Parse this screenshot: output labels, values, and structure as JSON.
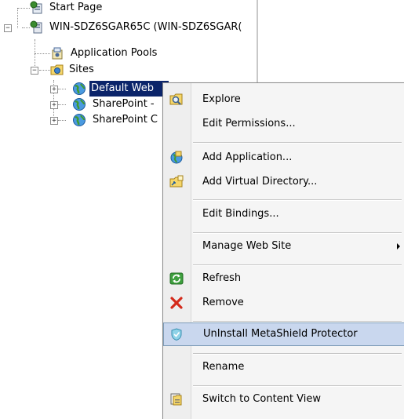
{
  "tree": {
    "nodes": [
      {
        "label": "Start Page"
      },
      {
        "label": "WIN-SDZ6SGAR65C (WIN-SDZ6SGAR("
      },
      {
        "label": "Application Pools"
      },
      {
        "label": "Sites"
      },
      {
        "label": "Default Web"
      },
      {
        "label": "SharePoint -"
      },
      {
        "label": "SharePoint C"
      }
    ],
    "selected_index": 4,
    "selection_color": "#0b246a"
  },
  "context_menu": {
    "items": [
      {
        "label": "Explore",
        "icon": "folder-search-icon"
      },
      {
        "label": "Edit Permissions..."
      },
      {
        "label": "Add Application...",
        "icon": "add-application-icon"
      },
      {
        "label": "Add Virtual Directory...",
        "icon": "add-virtual-directory-icon"
      },
      {
        "label": "Edit Bindings..."
      },
      {
        "label": "Manage Web Site",
        "submenu": true
      },
      {
        "label": "Refresh",
        "icon": "refresh-icon"
      },
      {
        "label": "Remove",
        "icon": "remove-x-icon"
      },
      {
        "label": "UnInstall MetaShield Protector",
        "icon": "shield-icon",
        "highlighted": true
      },
      {
        "label": "Rename"
      },
      {
        "label": "Switch to Content View",
        "icon": "content-view-icon"
      }
    ],
    "highlight_color": "#c9d7ee",
    "remove_icon_color": "#d42a1b"
  }
}
